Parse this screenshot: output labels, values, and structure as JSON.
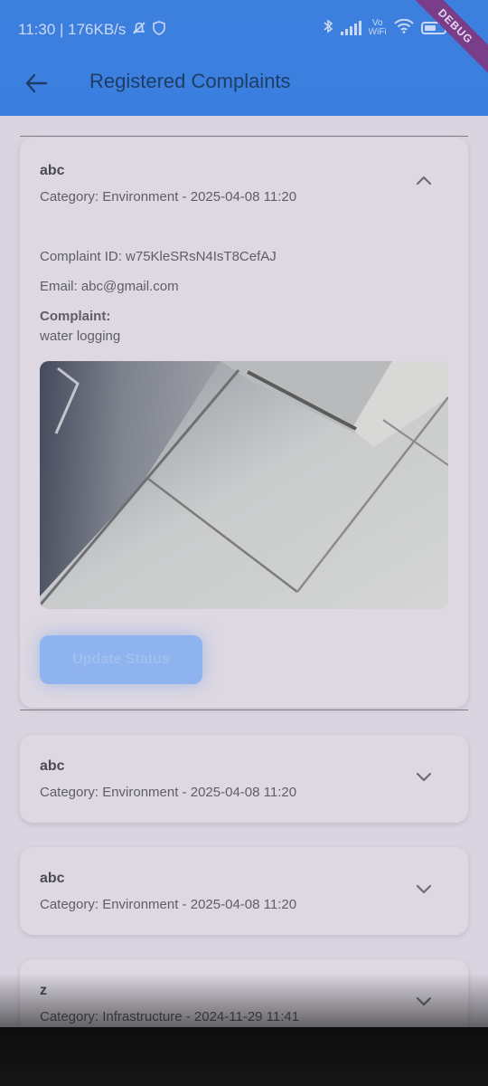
{
  "status_bar": {
    "time_speed": "11:30 | 176KB/s",
    "vowifi_top": "Vo",
    "vowifi_bottom": "WiFi",
    "battery": "5",
    "debug": "DEBUG"
  },
  "app_bar": {
    "title": "Registered Complaints"
  },
  "expanded_complaint": {
    "title": "abc",
    "subtitle": "Category: Environment - 2025-04-08 11:20",
    "id_line": "Complaint ID: w75KleSRsN4IsT8CefAJ",
    "email_line": "Email: abc@gmail.com",
    "complaint_label": "Complaint:",
    "complaint_text": "water logging",
    "update_button": "Update Status"
  },
  "complaints": [
    {
      "title": "abc",
      "subtitle": "Category: Environment - 2025-04-08 11:20"
    },
    {
      "title": "abc",
      "subtitle": "Category: Environment - 2025-04-08 11:20"
    },
    {
      "title": "z",
      "subtitle": "Category: Infrastructure - 2024-11-29 11:41"
    }
  ],
  "colors": {
    "app_bar": "#3a7fe0",
    "background": "#d9d4e0",
    "card": "#ddd8e2",
    "button": "#8fb3ee"
  }
}
